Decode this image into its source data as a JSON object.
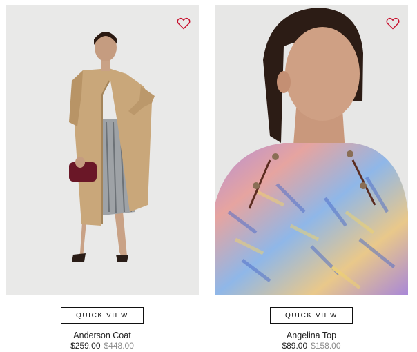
{
  "products": [
    {
      "name": "Anderson Coat",
      "sale_price": "$259.00",
      "original_price": "$448.00",
      "quick_view_label": "QUICK VIEW",
      "favorite_icon": "heart-outline-icon"
    },
    {
      "name": "Angelina Top",
      "sale_price": "$89.00",
      "original_price": "$158.00",
      "quick_view_label": "QUICK VIEW",
      "favorite_icon": "heart-outline-icon"
    }
  ],
  "colors": {
    "accent_heart": "#c8102e",
    "text": "#222222",
    "strikethrough_price": "#8a8a8a"
  }
}
